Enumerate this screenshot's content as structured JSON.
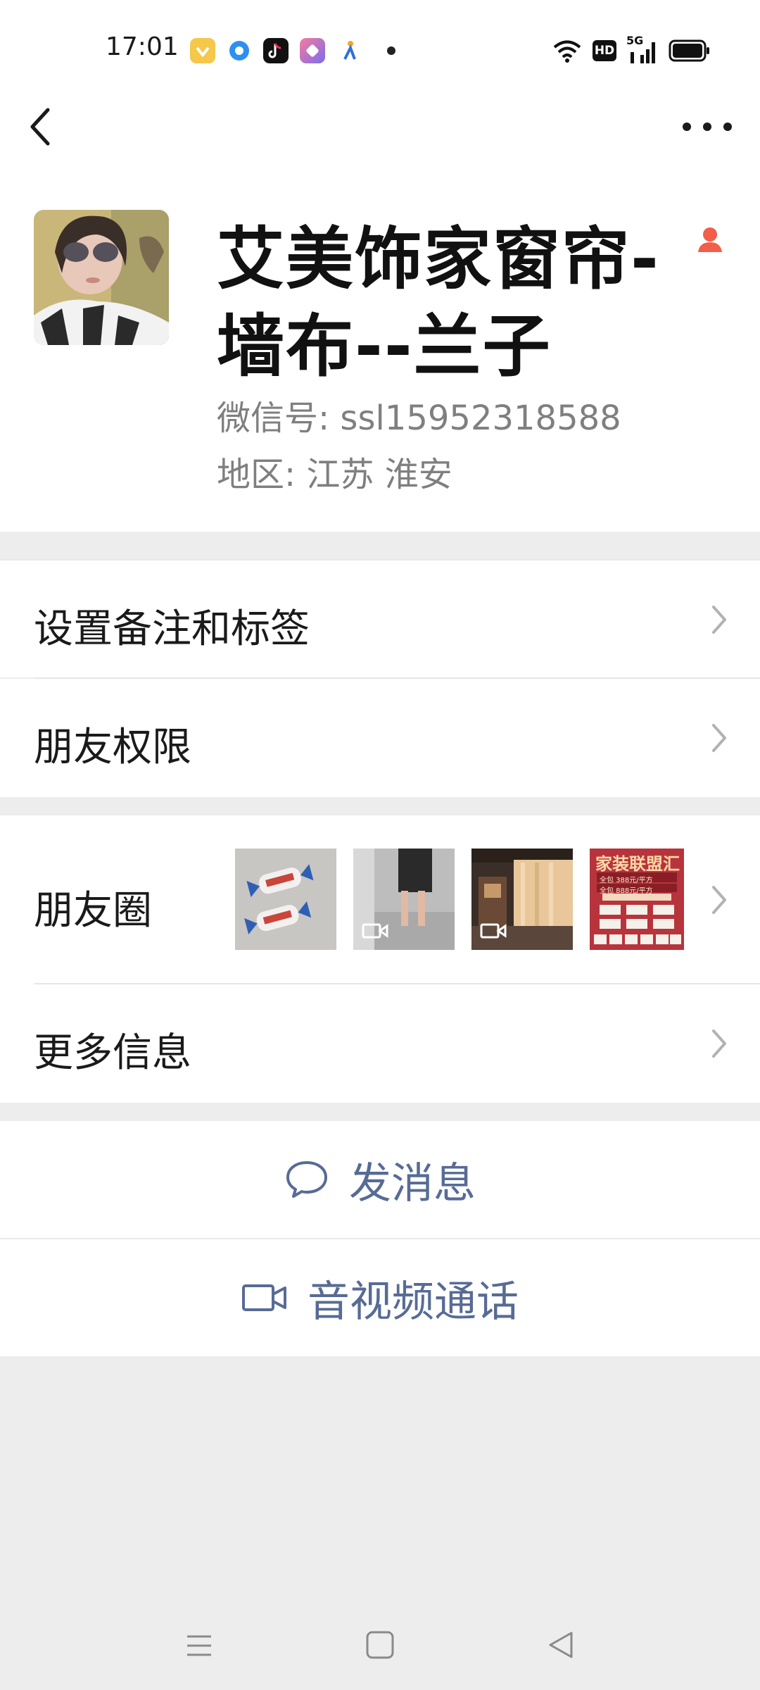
{
  "status_bar": {
    "time": "17:01",
    "network": "5G",
    "hd_badge": "HD"
  },
  "profile": {
    "name": "艾美饰家窗帘-墙布--兰子",
    "wechat_id": "微信号: ssl15952318588",
    "region": "地区: 江苏 淮安"
  },
  "menu": {
    "remark_tags": "设置备注和标签",
    "friend_permissions": "朋友权限",
    "moments": "朋友圈",
    "more_info": "更多信息"
  },
  "moments_thumbs": {
    "thumb4_title": "家装联盟汇",
    "thumb4_line1": "全包 388元/平方",
    "thumb4_line2": "全包 888元/平方"
  },
  "actions": {
    "send_message": "发消息",
    "call": "音视频通话"
  },
  "colors": {
    "link": "#576b95",
    "background": "#ededed",
    "badge": "#f25e48"
  }
}
